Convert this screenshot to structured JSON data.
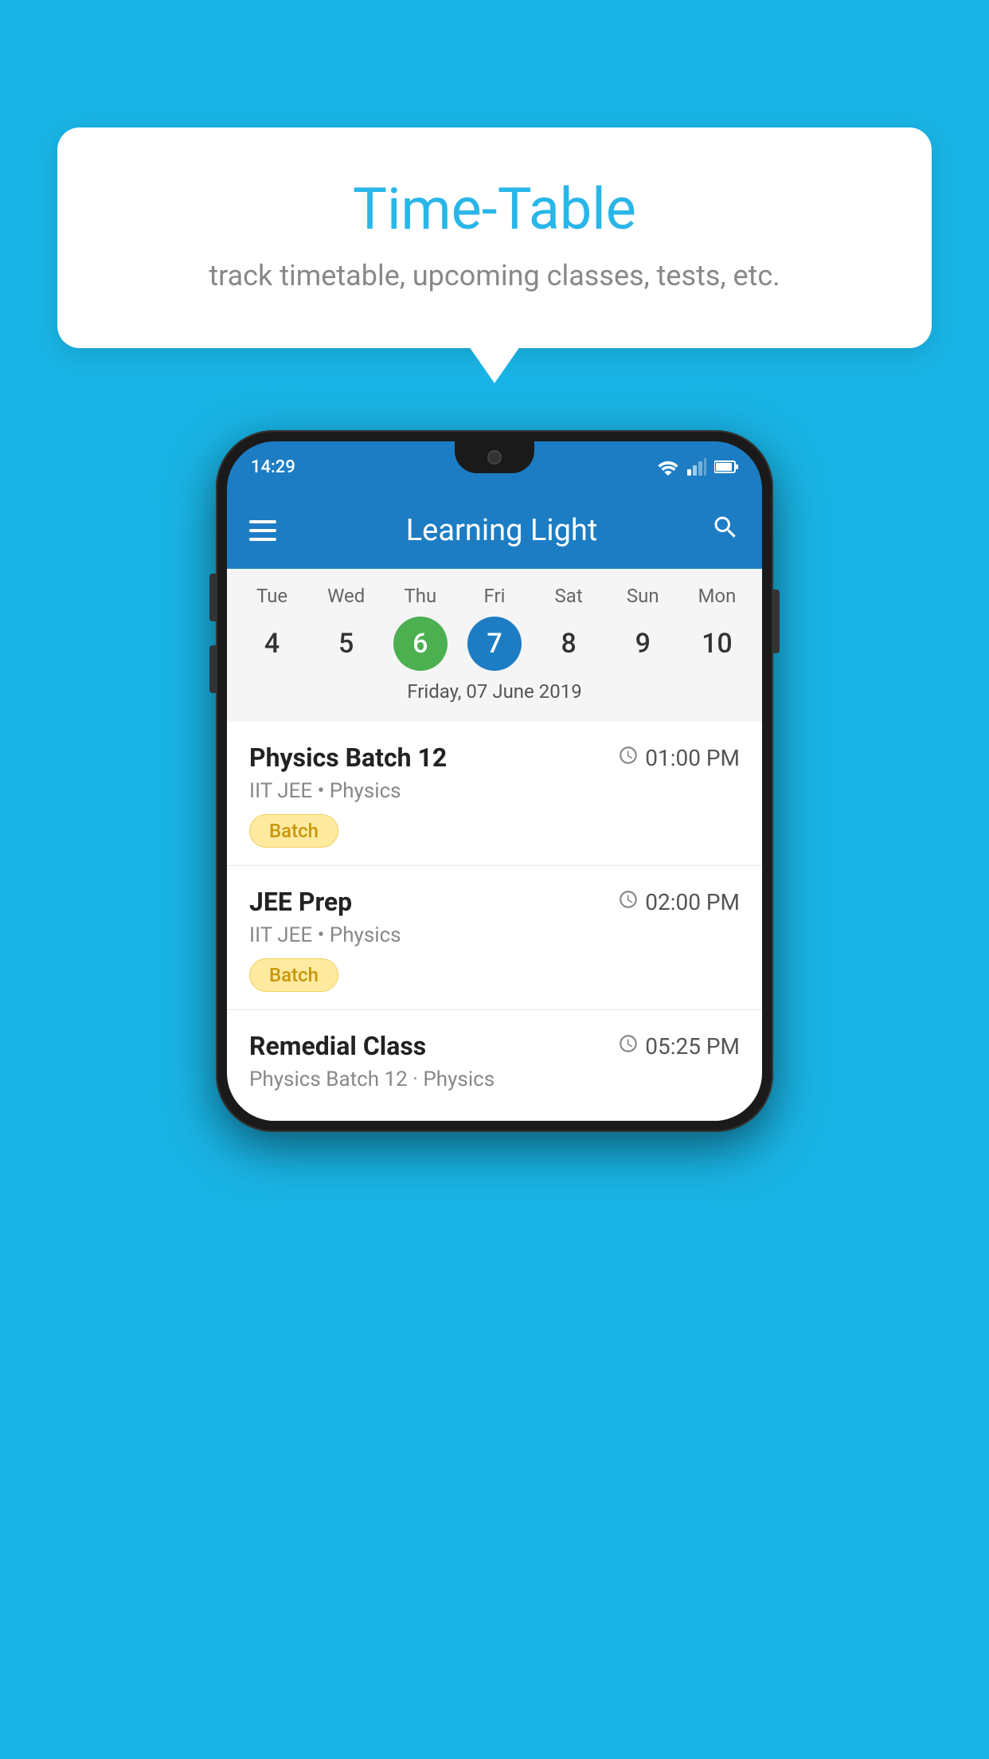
{
  "background_color": "#19b4e5",
  "tooltip": {
    "title": "Time-Table",
    "subtitle": "track timetable, upcoming classes, tests, etc."
  },
  "phone": {
    "status_bar": {
      "time": "14:29"
    },
    "app_bar": {
      "title": "Learning Light"
    },
    "calendar": {
      "days": [
        "Tue",
        "Wed",
        "Thu",
        "Fri",
        "Sat",
        "Sun",
        "Mon"
      ],
      "dates": [
        "4",
        "5",
        "6",
        "7",
        "8",
        "9",
        "10"
      ],
      "today_index": 2,
      "selected_index": 3,
      "selected_date_label": "Friday, 07 June 2019"
    },
    "schedule": [
      {
        "title": "Physics Batch 12",
        "time": "01:00 PM",
        "subtitle": "IIT JEE • Physics",
        "badge": "Batch"
      },
      {
        "title": "JEE Prep",
        "time": "02:00 PM",
        "subtitle": "IIT JEE • Physics",
        "badge": "Batch"
      },
      {
        "title": "Remedial Class",
        "time": "05:25 PM",
        "subtitle": "Physics Batch 12 · Physics",
        "badge": ""
      }
    ]
  },
  "icons": {
    "hamburger": "menu-icon",
    "search": "search-icon",
    "clock": "⏱"
  }
}
